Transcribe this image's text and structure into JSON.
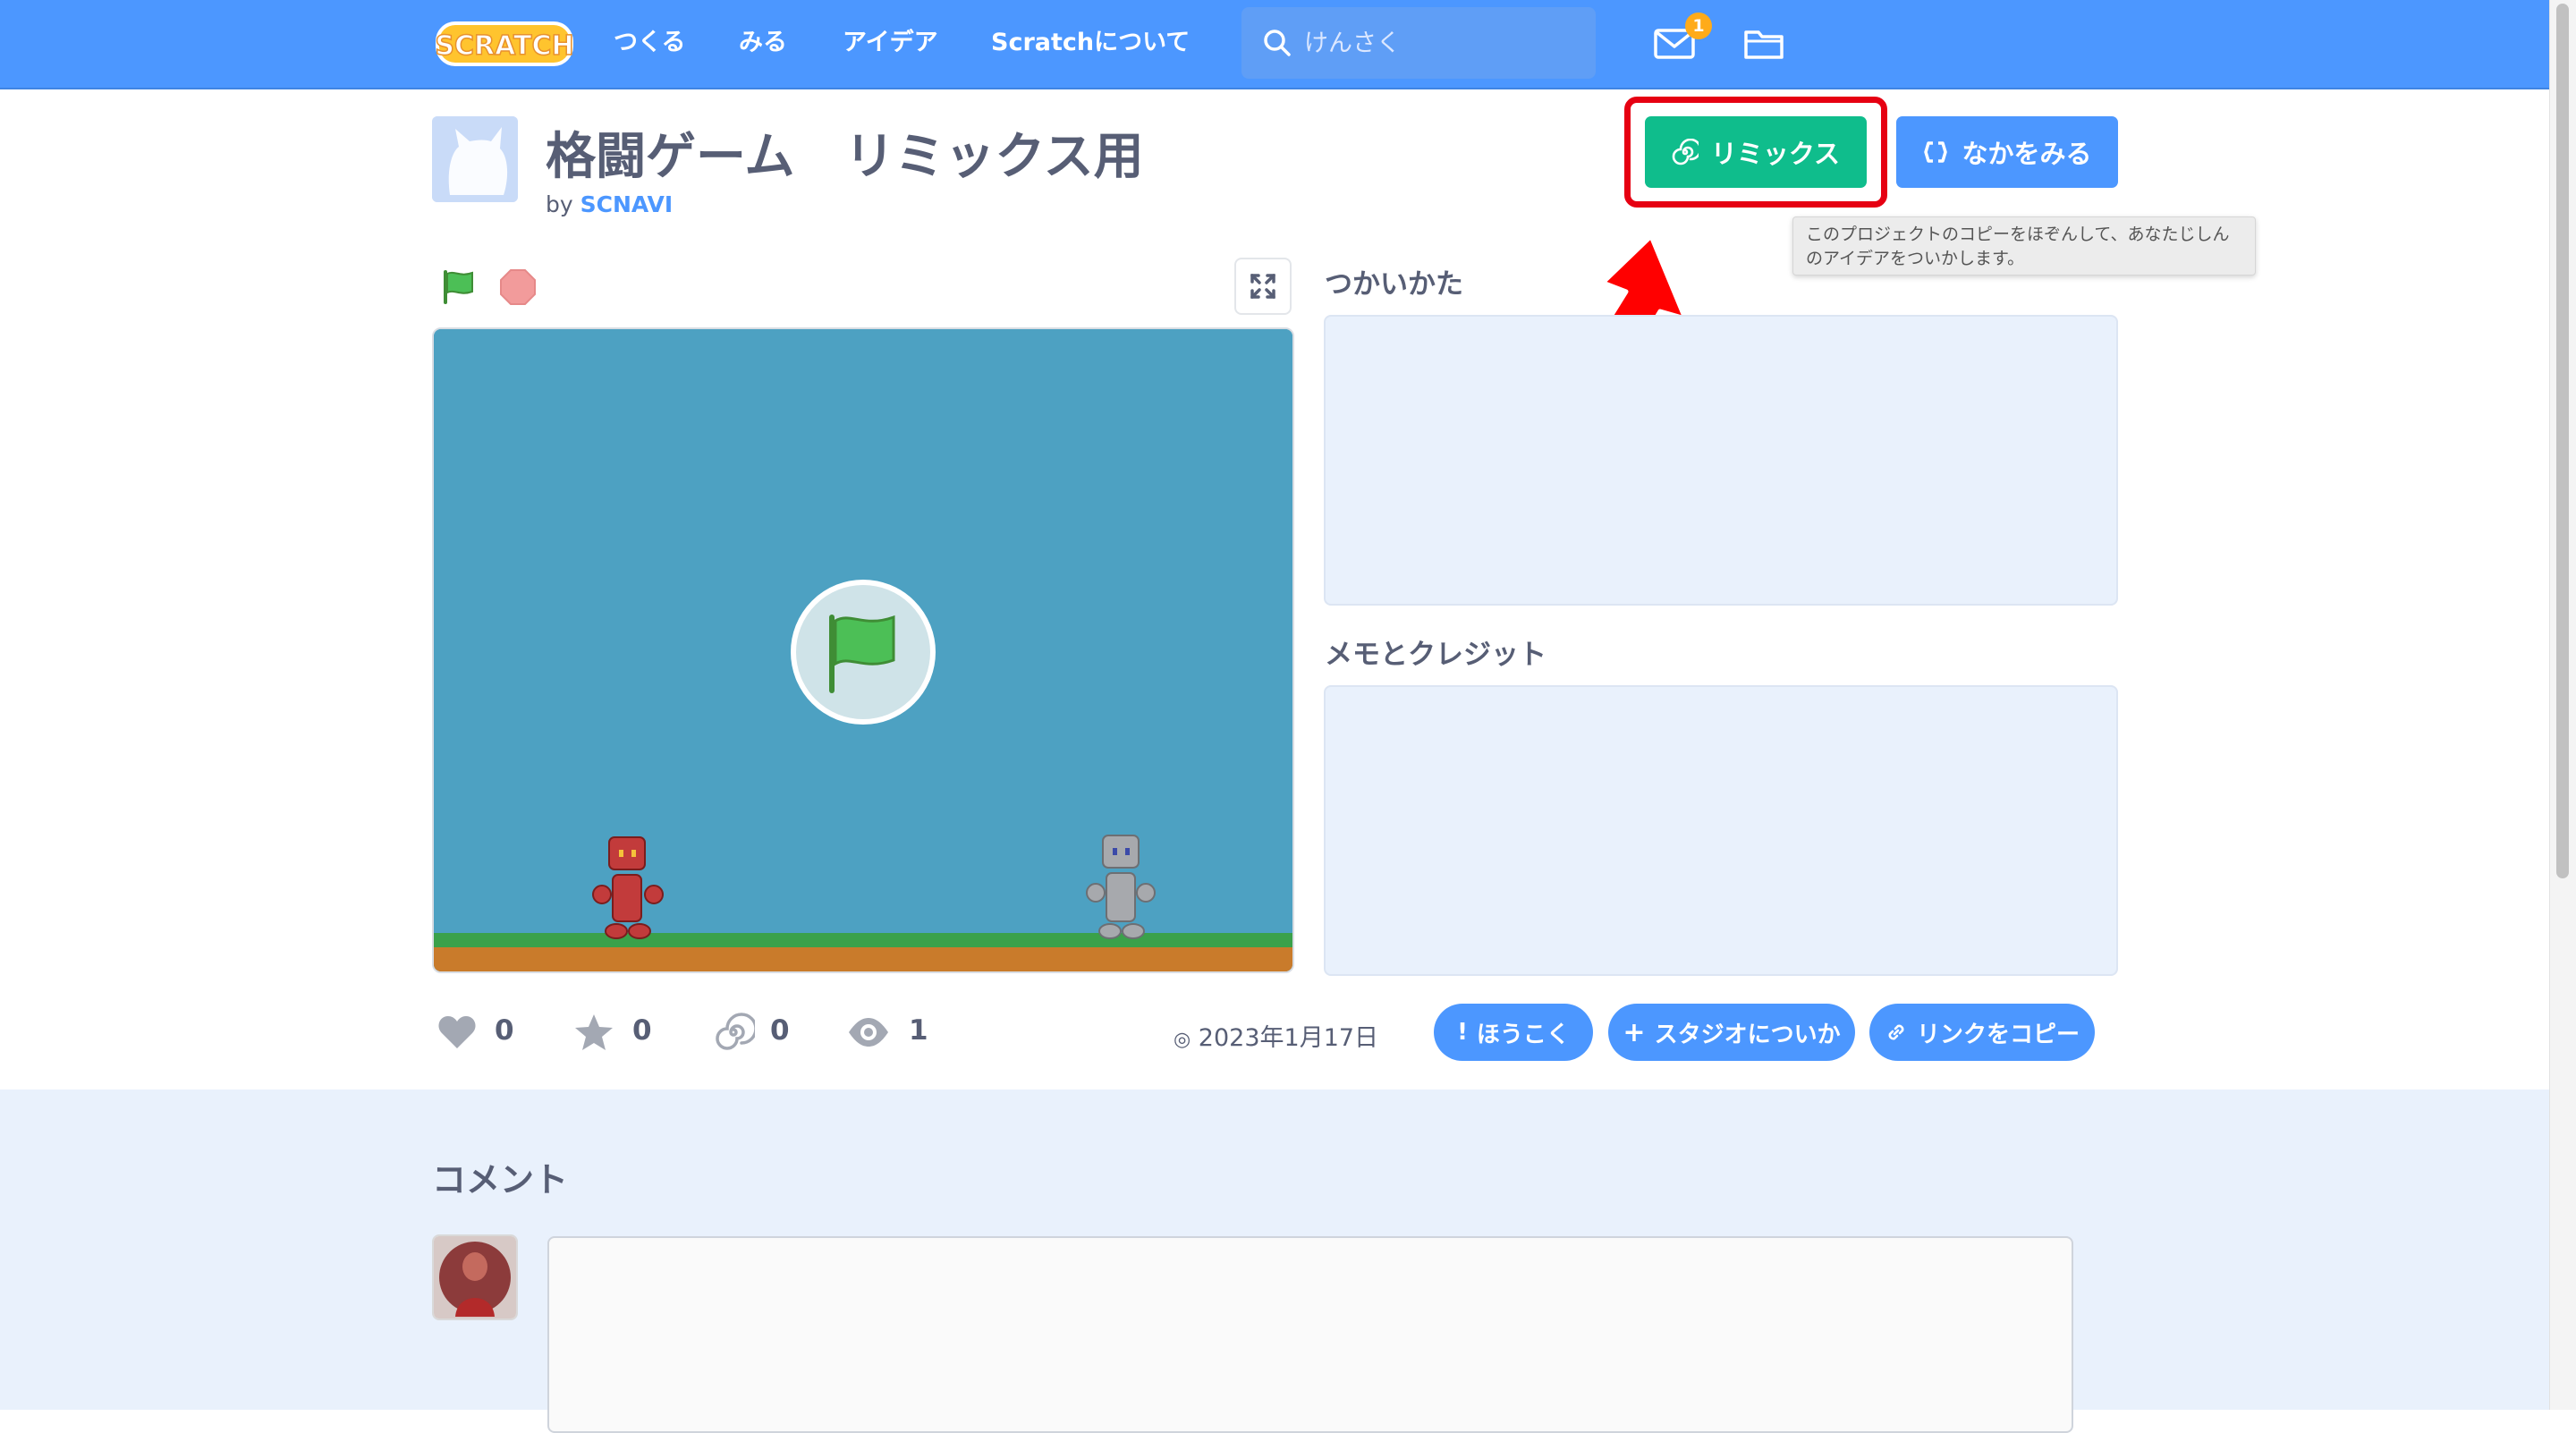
{
  "nav": {
    "logo_text": "SCRATCH",
    "links": [
      "つくる",
      "みる",
      "アイデア",
      "Scratchについて"
    ],
    "search_placeholder": "けんさく",
    "mail_count": "1"
  },
  "project": {
    "title": "格闘ゲーム　リミックス用",
    "by_label": "by",
    "author": "SCNAVI",
    "remix_label": "リミックス",
    "see_inside_label": "なかをみる",
    "remix_tooltip": "このプロジェクトのコピーをほぞんして、あなたじしんのアイデアをついかします。"
  },
  "sections": {
    "instructions_heading": "つかいかた",
    "notes_heading": "メモとクレジット"
  },
  "stats": {
    "loves": "0",
    "favorites": "0",
    "remixes": "0",
    "views": "1",
    "date": "2023年1月17日"
  },
  "actions": {
    "report_label": "ほうこく",
    "add_studio_label": "スタジオについか",
    "copy_link_label": "リンクをコピー"
  },
  "comments": {
    "heading": "コメント"
  },
  "colors": {
    "scratch_blue": "#4c97ff",
    "remix_green": "#0fbd8c",
    "highlight_red": "#e60012",
    "stage_sky": "#4da1c2",
    "panel_bg": "#e9f1fc"
  },
  "icons": [
    "scratch-logo",
    "search-icon",
    "mail-icon",
    "folder-icon",
    "remix-swirl-icon",
    "see-inside-icon",
    "green-flag-icon",
    "stop-icon",
    "fullscreen-icon",
    "heart-icon",
    "star-icon",
    "remix-count-icon",
    "eye-icon",
    "report-icon",
    "plus-icon",
    "link-icon"
  ]
}
